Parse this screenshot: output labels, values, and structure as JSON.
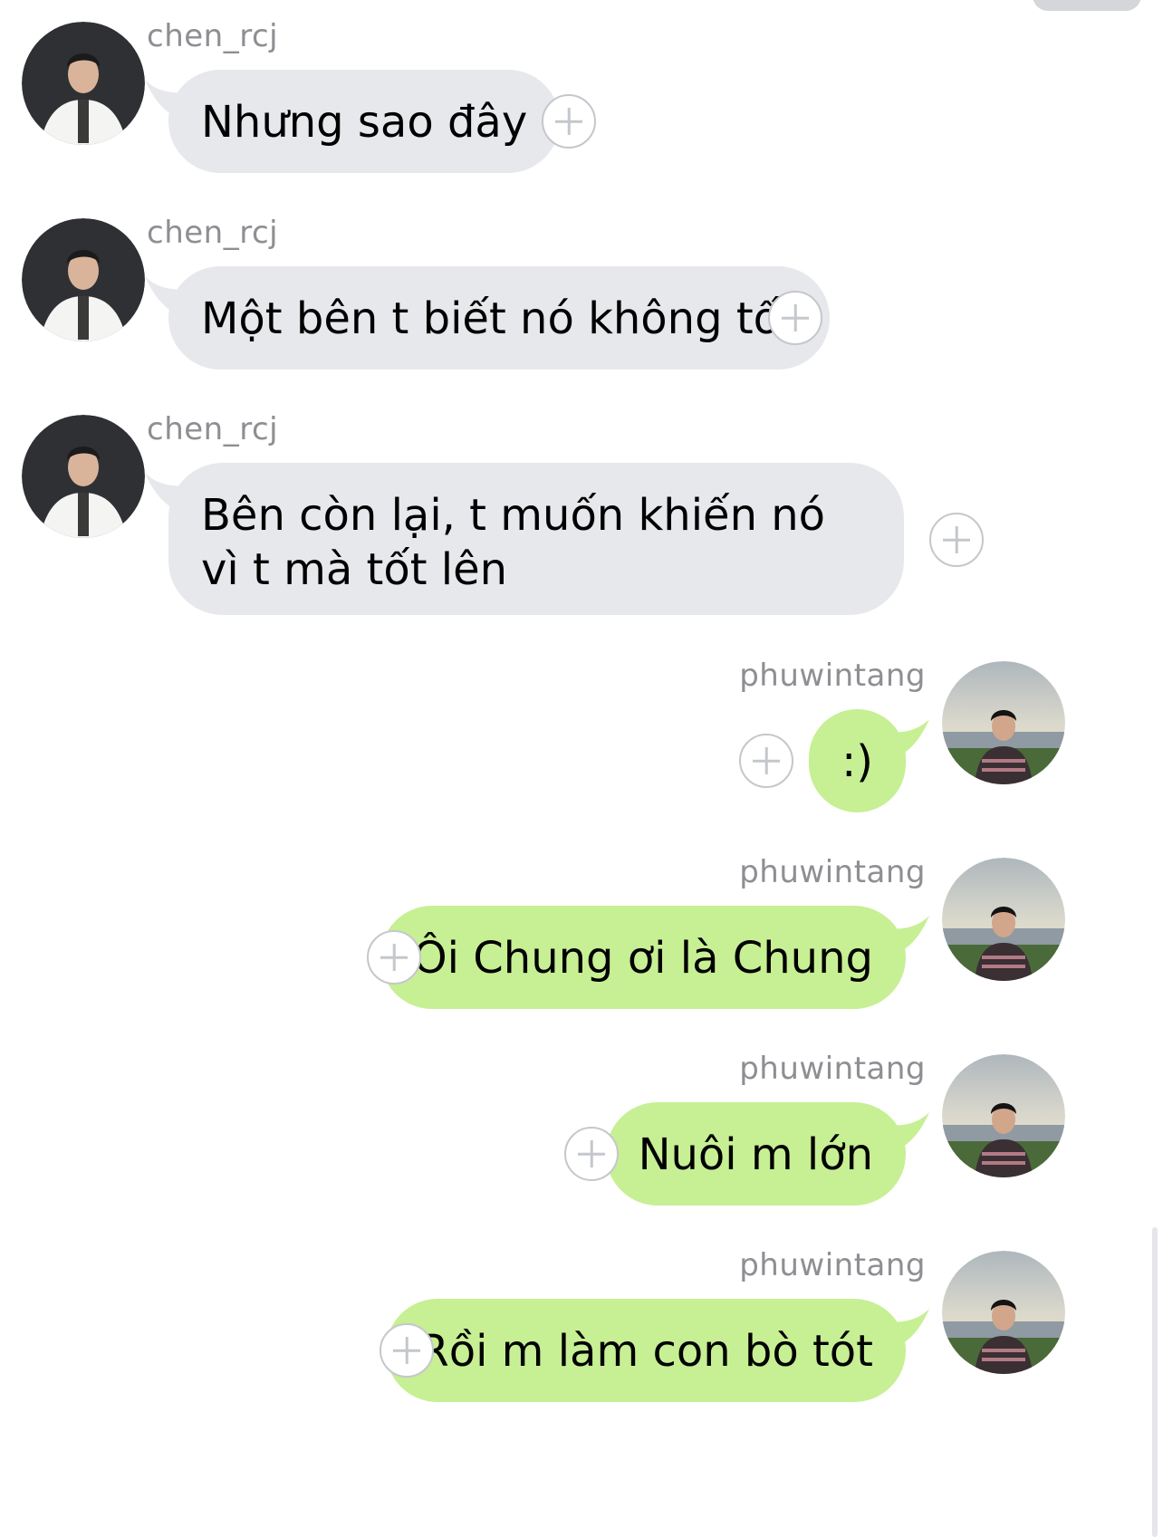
{
  "messages": [
    {
      "sender": "chen_rcj",
      "text": "Nhưng sao đây",
      "avatar_icon": "portrait-avatar-icon"
    },
    {
      "sender": "chen_rcj",
      "text": "Một bên t biết nó không tốt",
      "avatar_icon": "portrait-avatar-icon"
    },
    {
      "sender": "chen_rcj",
      "text": "Bên còn lại, t muốn khiến nó vì t mà tốt lên",
      "avatar_icon": "portrait-avatar-icon"
    },
    {
      "sender": "phuwintang",
      "text": ":)",
      "avatar_icon": "lakeside-avatar-icon"
    },
    {
      "sender": "phuwintang",
      "text": "Ôi Chung ơi là Chung",
      "avatar_icon": "lakeside-avatar-icon"
    },
    {
      "sender": "phuwintang",
      "text": "Nuôi m lớn",
      "avatar_icon": "lakeside-avatar-icon"
    },
    {
      "sender": "phuwintang",
      "text": "Rồi m làm con bò tót",
      "avatar_icon": "lakeside-avatar-icon"
    }
  ],
  "colors": {
    "incoming_bubble": "#e6e8eb",
    "outgoing_bubble": "#c7ef94",
    "username": "#8e8e93",
    "reaction_icon": "#c4c7cc"
  },
  "icons": {
    "reaction": "add-reaction-icon"
  }
}
